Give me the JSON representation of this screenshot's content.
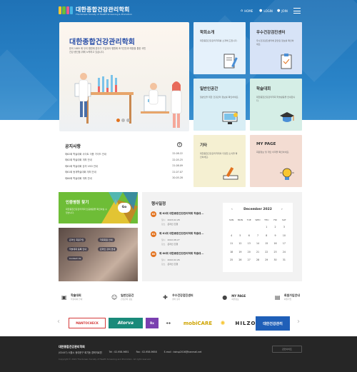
{
  "header": {
    "logo_title": "대한종합건강관리학회",
    "logo_subtitle": "The Korean Society of Health Screening & Promotion",
    "nav": [
      {
        "label": "HOME",
        "icon": "home-icon"
      },
      {
        "label": "LOGIN",
        "icon": "user-icon"
      },
      {
        "label": "JOIN",
        "icon": "user-plus-icon"
      }
    ]
  },
  "hero": {
    "title": "대한종합건강관리학회",
    "text": "한국 1885 에 우리 병원에 본다가 기입되어 병원에 조기진단과 예방을 통한 국민 건강 증진을 위해 노력하고 있습니다."
  },
  "tiles": [
    {
      "title": "학회소개",
      "desc": "대한종합건강관리학회를 소개해 드립니다.",
      "color": "#e5f1fb",
      "icon": "document-pen-icon"
    },
    {
      "title": "우수건강검진센터",
      "desc": "우수건강검진센터에 관련된 정보를 확인하세요.",
      "color": "#d7e3f7",
      "icon": "clipboard-check-icon"
    },
    {
      "title": "일반인공간",
      "desc": "일반인을 위한 건강관리 정보를 확인하세요.",
      "color": "#d9eef5",
      "icon": "computer-icon"
    },
    {
      "title": "학술대회",
      "desc": "대한종합건강관리학회 학술활동을 안내합니다.",
      "color": "#d5eee6",
      "icon": "graduation-cap-icon"
    },
    {
      "title": "기타",
      "desc": "대한종합건강관리학회의 다양한 소식을 확인하세요.",
      "color": "#f5f0d2",
      "icon": "pencil-ruler-icon"
    },
    {
      "title": "MY PAGE",
      "desc": "회원정보 및 개인 이력을 확인하세요.",
      "color": "#f3dcd2",
      "icon": "lightbulb-icon"
    }
  ],
  "notice": {
    "title": "공지사항",
    "items": [
      {
        "text": "제62회 학술대회 사이트 이용 가이드 안내",
        "date": "22.08.22"
      },
      {
        "text": "제62회 학술대회 개최 안내",
        "date": "22.05.25"
      },
      {
        "text": "제61회 학술대회 강의 VOD 안내",
        "date": "21.08.09"
      },
      {
        "text": "제61회 동계학술대회 개최 안내",
        "date": "21.07.07"
      },
      {
        "text": "제60회 학술대회 개최 안내",
        "date": "20.05.28"
      }
    ]
  },
  "certification": {
    "title": "인증병원 찾기",
    "desc": "대한종합건강관리학회 인증병원을 확인하실 수 있습니다.",
    "button": "Go"
  },
  "photo_links": [
    "온라인 회원가입",
    "학회회원 안내",
    "학술대회 등록 안내",
    "온라인 강의 안내",
    "Contact Us"
  ],
  "schedule": {
    "title": "행사일정",
    "events": [
      {
        "num": "62",
        "title": "제 62회 대한종합건강관리학회 학술대...",
        "date_label": "일시",
        "date": "2023.02.28",
        "place_label": "장소",
        "place": "온라인 진행"
      },
      {
        "num": "61",
        "title": "제 61회 대한종합건강관리학회 학술대...",
        "date_label": "일시",
        "date": "2022.08.27",
        "place_label": "장소",
        "place": "온라인 진행"
      },
      {
        "num": "60",
        "title": "제 60회 대한종합건강관리학회 학술대...",
        "date_label": "일시",
        "date": "2022.02.26",
        "place_label": "장소",
        "place": "온라인 진행"
      }
    ]
  },
  "calendar": {
    "month": "December 2022",
    "weekdays": [
      "SUN",
      "MON",
      "TUE",
      "WED",
      "THU",
      "FRI",
      "SAT"
    ],
    "days": [
      "",
      "",
      "",
      "",
      "1",
      "2",
      "3",
      "4",
      "5",
      "6",
      "7",
      "8",
      "9",
      "10",
      "11",
      "12",
      "13",
      "14",
      "15",
      "16",
      "17",
      "18",
      "19",
      "20",
      "21",
      "22",
      "23",
      "24",
      "25",
      "26",
      "27",
      "28",
      "29",
      "30",
      "31"
    ]
  },
  "quick_links": [
    {
      "label": "학술대회",
      "sub": "학술대회 안내",
      "icon": "podium-icon"
    },
    {
      "label": "일반인공간",
      "sub": "건강관리 정보",
      "icon": "people-icon"
    },
    {
      "label": "우수건강검진센터",
      "sub": "센터 찾기",
      "icon": "hospital-icon"
    },
    {
      "label": "MY PAGE",
      "sub": "회원정보",
      "icon": "person-icon"
    },
    {
      "label": "회원가입안내",
      "sub": "회원가입",
      "icon": "member-card-icon"
    }
  ],
  "partners": [
    {
      "name": "MANTOCHECK",
      "color": "#d43b3b"
    },
    {
      "name": "Atorva",
      "color": "#1a8a7a"
    },
    {
      "name": "Rx",
      "color": "#7a3fb0"
    },
    {
      "name": "mobiCARE",
      "color": "#cfa400"
    },
    {
      "name": "HILZO",
      "color": "#222222"
    },
    {
      "name": "대한건강관리",
      "color": "#1f5fb8"
    }
  ],
  "footer": {
    "title": "대한종합건강관리학회",
    "address": "(02447) 서울시 동대문구 회기동 경희의료원",
    "tel": "Tel : 02-958-9651",
    "fax": "Fax : 02-958-9658",
    "email": "E-mail : kshsp2016@hanmail.net",
    "copyright": "Copyright © 2022 The Korean Society of Health Screening and Promotion. All right reserved.",
    "family_site": "관련사이트"
  },
  "colors": {
    "primary": "#2a7dc2",
    "accent": "#e2731f",
    "green": "#6ebd37"
  }
}
